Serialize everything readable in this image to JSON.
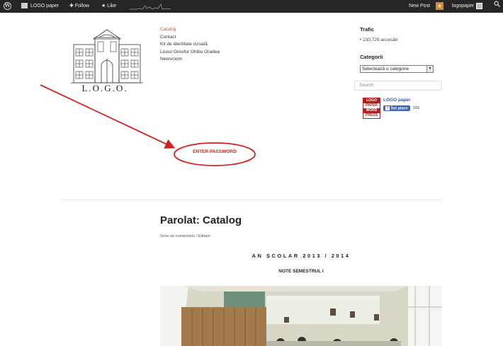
{
  "adminbar": {
    "site_name": "LOGO paper",
    "follow": "Follow",
    "like": "Like",
    "new_post": "New Post",
    "notifications": "★",
    "username": "logopaper"
  },
  "logo": {
    "text": "L.O.G.O."
  },
  "nav": {
    "items": [
      {
        "label": "Catalog",
        "active": true
      },
      {
        "label": "Contact"
      },
      {
        "label": "Kit de identitate vizuală"
      },
      {
        "label": "Liceul Onisifor Ghibu Oradea"
      },
      {
        "label": "Newsroom"
      }
    ]
  },
  "sidebar": {
    "trafic_title": "Trafic",
    "trafic_stat": "230,729 accesări",
    "categorii_title": "Categorii",
    "category_select": "Selectează o categorie",
    "search_placeholder": "Search",
    "fb_badge": [
      "LOGO",
      "PAPER",
      "WORD",
      "PRESS"
    ],
    "fb_page_name": "LOGO paper",
    "fb_like_label": "Îmi place",
    "fb_count": "316"
  },
  "annotation": {
    "label": "ENTER PASSWORD",
    "color": "#d22020"
  },
  "post": {
    "title": "Parolat: Catalog",
    "comment_link": "Scrie un comentariu",
    "edit_link": "Editare",
    "school_year": "AN ȘCOLAR 2013 / 2014",
    "subtitle": "NOTE SEMESTRUL I"
  },
  "colors": {
    "adminbar_bg": "#262626",
    "active_nav": "#d05a3b",
    "fb_blue": "#3b5998"
  }
}
